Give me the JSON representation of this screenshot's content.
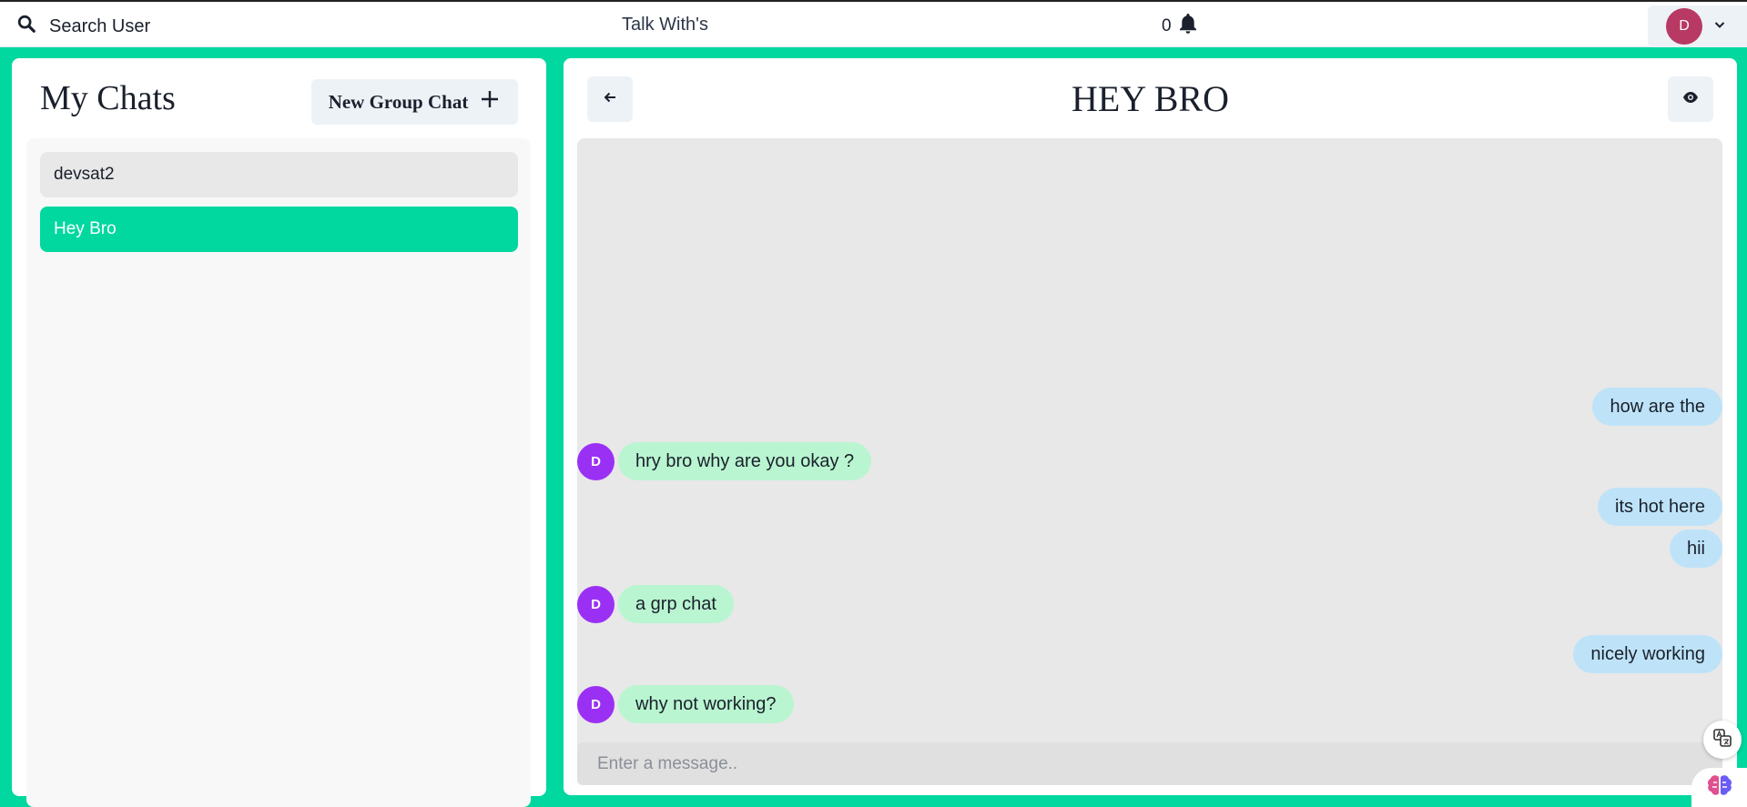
{
  "header": {
    "search_label": "Search User",
    "app_title": "Talk With's",
    "notification_count": "0",
    "user_initial": "D"
  },
  "sidebar": {
    "title": "My Chats",
    "new_group_label": "New Group Chat",
    "chats": [
      {
        "name": "devsat2",
        "active": false
      },
      {
        "name": "Hey Bro",
        "active": true
      }
    ]
  },
  "chat": {
    "title": "HEY BRO",
    "messages": [
      {
        "text": "how are the",
        "sender": "me"
      },
      {
        "text": "hry bro why are you okay ?",
        "sender": "other",
        "initial": "D"
      },
      {
        "text": "its hot here",
        "sender": "me"
      },
      {
        "text": "hii",
        "sender": "me"
      },
      {
        "text": "a grp chat",
        "sender": "other",
        "initial": "D"
      },
      {
        "text": "nicely working",
        "sender": "me"
      },
      {
        "text": "why not working?",
        "sender": "other",
        "initial": "D"
      }
    ],
    "input_placeholder": "Enter a message.."
  },
  "colors": {
    "brand": "#00d8a0",
    "sent_bubble": "#bee3f8",
    "received_bubble": "#b9f5d0",
    "avatar_main": "#b83963",
    "avatar_sender": "#9b30f5"
  }
}
